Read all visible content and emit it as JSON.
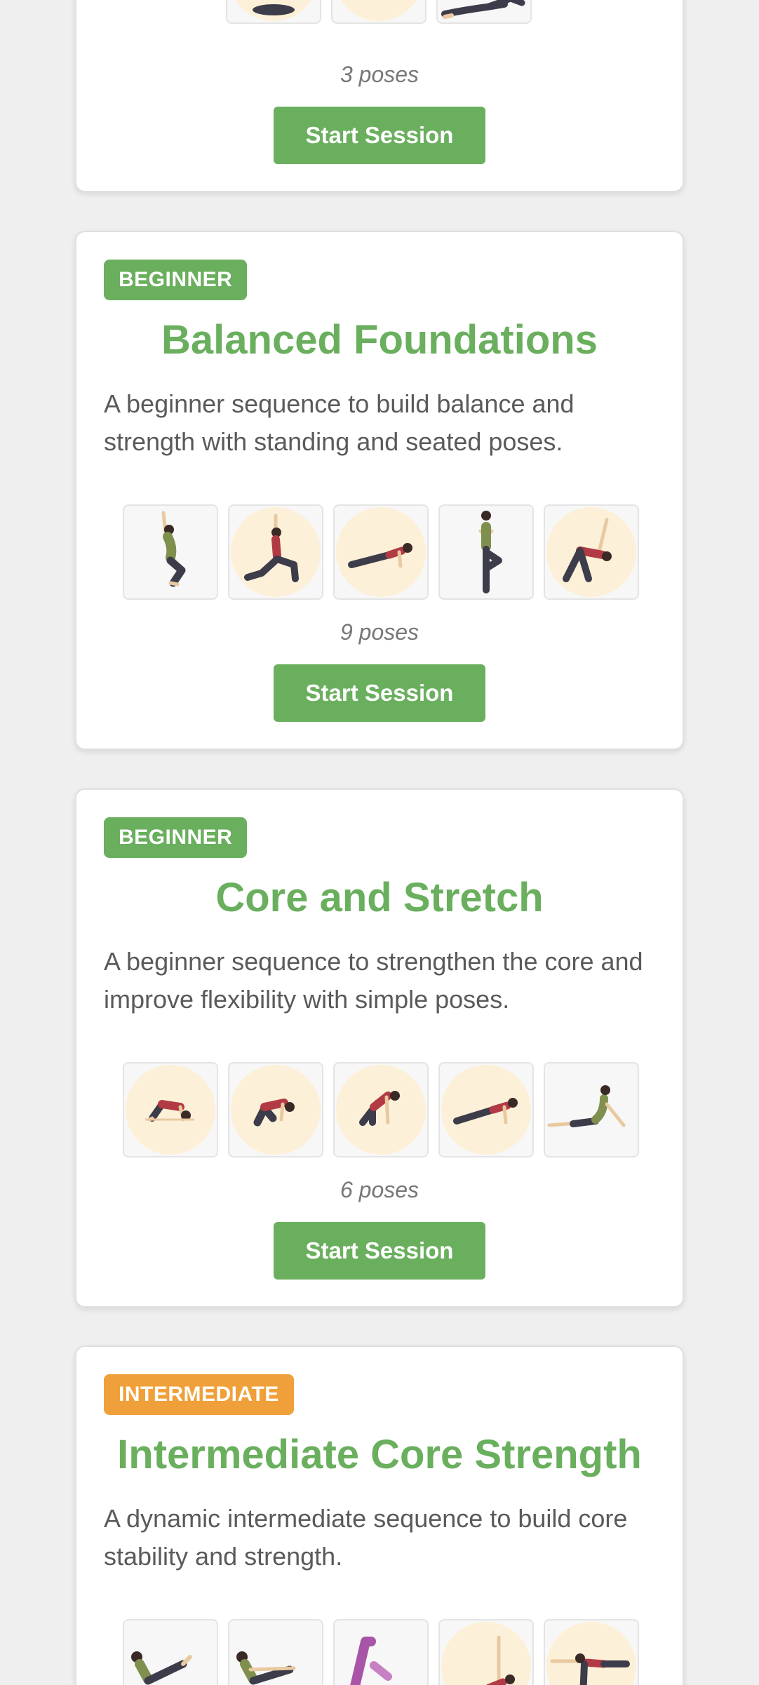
{
  "sessions": [
    {
      "pose_count": "3 poses",
      "start_label": "Start Session",
      "poses": [
        {
          "icon": "pose-figure-icon",
          "bg": "disc"
        },
        {
          "icon": "pose-figure-icon",
          "bg": "disc"
        },
        {
          "icon": "reclining-pose-icon",
          "bg": "plain"
        }
      ]
    },
    {
      "level": "BEGINNER",
      "title": "Balanced Foundations",
      "description": "A beginner sequence to build balance and strength with standing and seated poses.",
      "pose_count": "9 poses",
      "start_label": "Start Session",
      "poses": [
        {
          "icon": "chair-pose-icon",
          "bg": "plain"
        },
        {
          "icon": "crescent-lunge-pose-icon",
          "bg": "disc"
        },
        {
          "icon": "plank-pose-icon",
          "bg": "disc"
        },
        {
          "icon": "tree-pose-icon",
          "bg": "plain"
        },
        {
          "icon": "triangle-pose-icon",
          "bg": "disc"
        }
      ]
    },
    {
      "level": "BEGINNER",
      "title": "Core and Stretch",
      "description": "A beginner sequence to strengthen the core and improve flexibility with simple poses.",
      "pose_count": "6 poses",
      "start_label": "Start Session",
      "poses": [
        {
          "icon": "bridge-pose-icon",
          "bg": "disc"
        },
        {
          "icon": "childs-pose-icon",
          "bg": "disc"
        },
        {
          "icon": "tabletop-pose-icon",
          "bg": "disc"
        },
        {
          "icon": "plank-pose-icon",
          "bg": "disc"
        },
        {
          "icon": "cobra-pose-icon",
          "bg": "plain"
        }
      ]
    },
    {
      "level": "INTERMEDIATE",
      "title": "Intermediate Core Strength",
      "description": "A dynamic intermediate sequence to build core stability and strength.",
      "poses": [
        {
          "icon": "boat-pose-icon",
          "bg": "plain"
        },
        {
          "icon": "half-boat-pose-icon",
          "bg": "plain"
        },
        {
          "icon": "downward-dog-pose-icon",
          "bg": "plain"
        },
        {
          "icon": "side-plank-pose-icon",
          "bg": "disc"
        },
        {
          "icon": "warrior-three-pose-icon",
          "bg": "disc"
        }
      ]
    }
  ],
  "colors": {
    "beginner": "#6aaf5e",
    "intermediate": "#f0a03a",
    "title": "#6aaf5e",
    "button": "#6aaf5e"
  }
}
